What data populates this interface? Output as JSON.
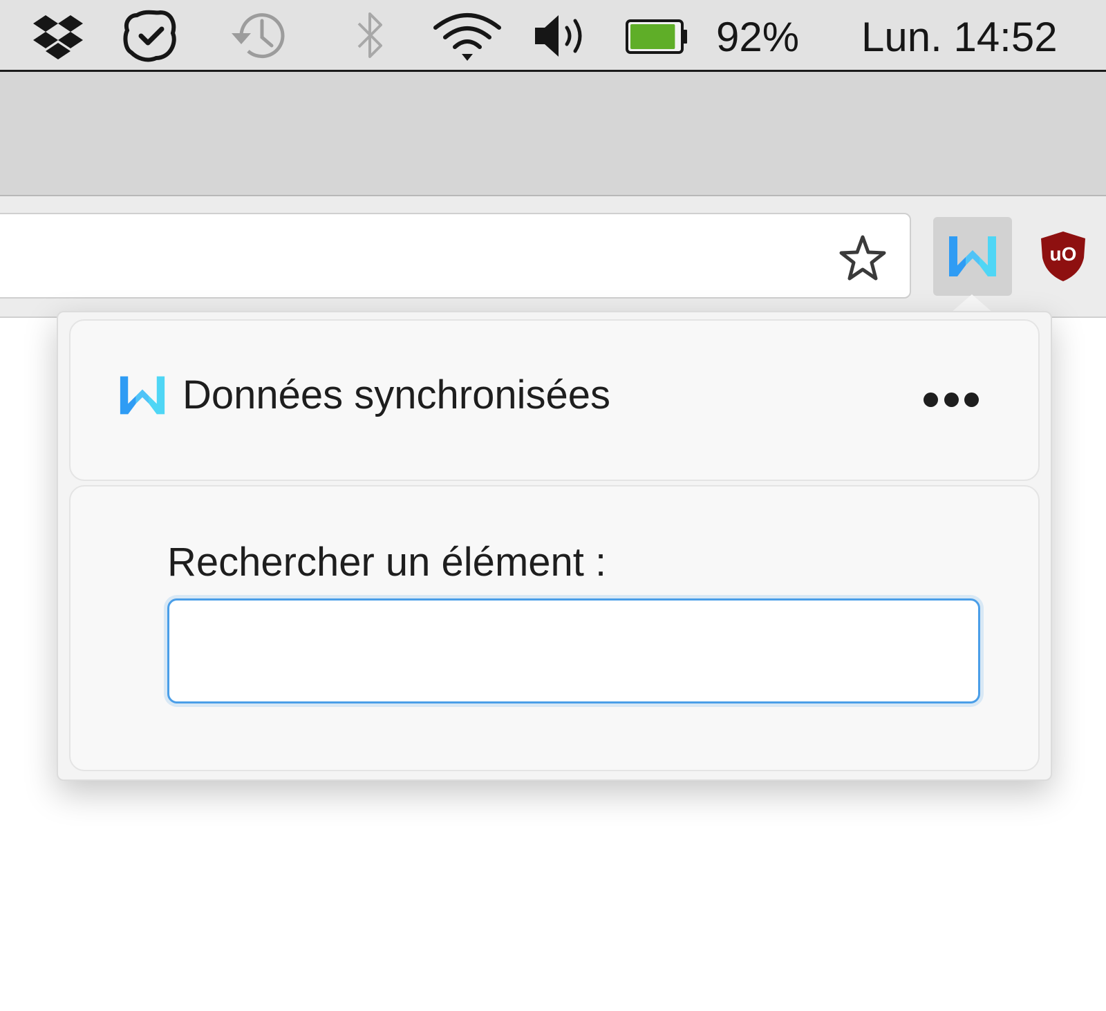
{
  "menubar": {
    "battery_percent_text": "92%",
    "battery_level": 0.92,
    "clock": "Lun. 14:52",
    "icons": [
      "dropbox-icon",
      "checkmark-bubble-icon",
      "time-machine-icon",
      "bluetooth-icon",
      "wifi-icon",
      "volume-icon",
      "battery-icon"
    ]
  },
  "toolbar": {
    "icons": [
      "bookmark-star-icon",
      "extension-w-icon",
      "ublock-origin-icon"
    ],
    "ublock_label": "uO"
  },
  "popup": {
    "title": "Données synchronisées",
    "menu_icon": "more-options-icon",
    "search_label": "Rechercher un élément :",
    "search_value": ""
  },
  "colors": {
    "brand_blue": "#2f9cf4",
    "brand_cyan": "#4fd6f5",
    "focus_blue": "#4a9ee8",
    "battery_green": "#5fae28",
    "ublock_red": "#8e1010"
  }
}
